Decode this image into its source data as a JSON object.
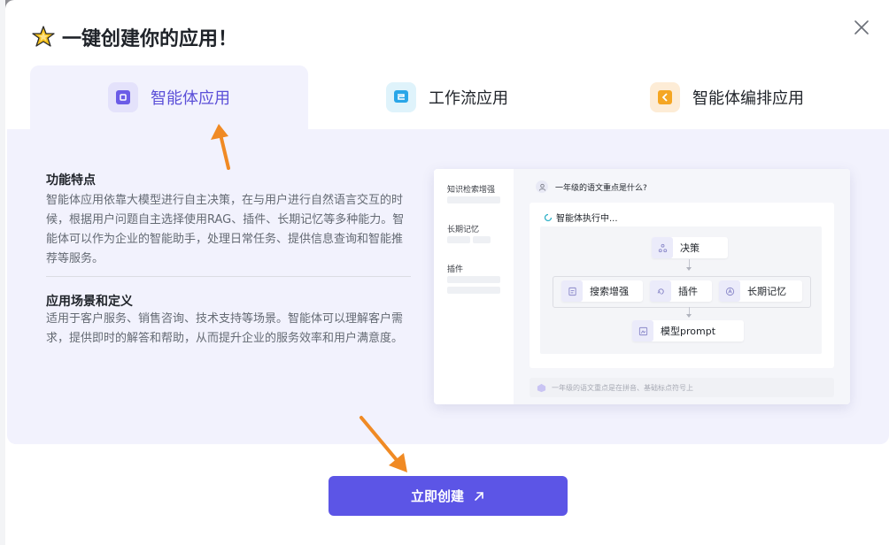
{
  "modal": {
    "title": "一键创建你的应用！",
    "title_icon": "sparkle-star-icon"
  },
  "tabs": [
    {
      "label": "智能体应用",
      "icon": "agent-app-icon",
      "active": true
    },
    {
      "label": "工作流应用",
      "icon": "workflow-app-icon",
      "active": false
    },
    {
      "label": "智能体编排应用",
      "icon": "agent-orchestration-icon",
      "active": false
    }
  ],
  "features": {
    "title": "功能特点",
    "text": "智能体应用依靠大模型进行自主决策，在与用户进行自然语言交互的时候，根据用户问题自主选择使用RAG、插件、长期记忆等多种能力。智能体可以作为企业的智能助手，处理日常任务、提供信息查询和智能推荐等服务。"
  },
  "scenarios": {
    "title": "应用场景和定义",
    "text": "适用于客户服务、销售咨询、技术支持等场景。智能体可以理解客户需求，提供即时的解答和帮助，从而提升企业的服务效率和用户满意度。"
  },
  "preview": {
    "sidebar": [
      "知识检索增强",
      "长期记忆",
      "插件"
    ],
    "question": "一年级的语文重点是什么?",
    "executing": "智能体执行中...",
    "nodes": {
      "decision": "决策",
      "search": "搜索增强",
      "plugin": "插件",
      "memory": "长期记忆",
      "model": "模型prompt"
    },
    "answer_hint": "一年级的语文重点是在拼音、基础标点符号上"
  },
  "create_button": {
    "label": "立即创建",
    "icon": "arrow-up-right-icon"
  },
  "colors": {
    "accent": "#5c55e6",
    "active_tab_text": "#5b4fd8",
    "panel_bg": "#f2f2fd",
    "annotation_arrow": "#f08a24"
  }
}
